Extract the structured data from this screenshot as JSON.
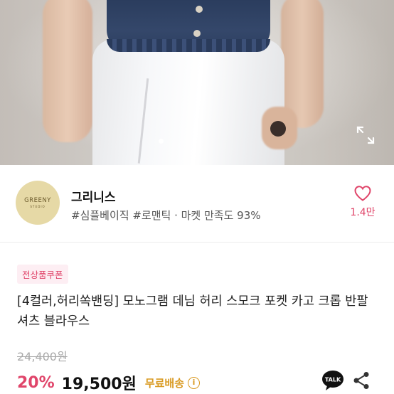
{
  "photo": {
    "expand_icon": "expand-arrows-icon"
  },
  "seller": {
    "logo_text": "GREENY",
    "logo_sub": "STUDIO",
    "name": "그리니스",
    "tags": "#심플베이직 #로맨틱 · 마켓 만족도 93%",
    "like_count": "1.4만",
    "heart_color": "#e0456a"
  },
  "product": {
    "coupon_badge": "전상품쿠폰",
    "title": "[4컬러,허리쏙밴딩] 모노그램 데님 허리 스모크 포켓 카고 크롭 반팔 셔츠 블라우스",
    "original_price": "24,400원",
    "discount": "20%",
    "price": "19,500원",
    "shipping": "무료배송",
    "info_icon": "ⓘ"
  },
  "actions": {
    "talk_label": "TALK",
    "talk_icon": "kakao-talk-icon",
    "share_icon": "share-icon"
  },
  "colors": {
    "accent": "#e0456a",
    "shipping": "#d99a22"
  }
}
